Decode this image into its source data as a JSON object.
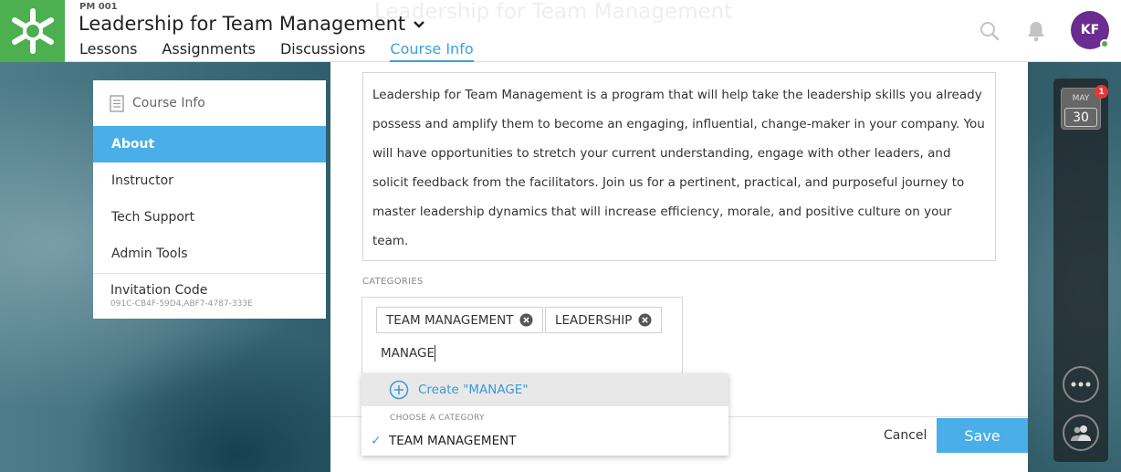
{
  "header": {
    "course_code": "PM 001",
    "course_title": "Leadership for Team Management",
    "ghost_title": "Leadership for Team Management",
    "tabs": [
      {
        "label": "Lessons"
      },
      {
        "label": "Assignments"
      },
      {
        "label": "Discussions"
      },
      {
        "label": "Course Info",
        "active": true
      }
    ],
    "user_initials": "KF"
  },
  "sidebar": {
    "heading": "Course Info",
    "items": [
      {
        "label": "About",
        "active": true
      },
      {
        "label": "Instructor"
      },
      {
        "label": "Tech Support"
      },
      {
        "label": "Admin Tools"
      }
    ],
    "invitation_label": "Invitation Code",
    "invitation_code": "091C-CB4F-59D4,ABF7-4787-333E"
  },
  "main": {
    "description": "Leadership for Team Management is a program that will help take the leadership skills you already possess and amplify them to become an engaging, influential, change-maker in your company. You will have opportunities to stretch your current understanding, engage with other leaders, and solicit feedback from the facilitators. Join us for a pertinent, practical, and purposeful journey to master leadership dynamics that will increase efficiency, morale, and positive culture on your team.",
    "categories_label": "CATEGORIES",
    "tags": [
      "TEAM MANAGEMENT",
      "LEADERSHIP"
    ],
    "typed_value": "MANAGE",
    "cancel_label": "Cancel",
    "save_label": "Save"
  },
  "dropdown": {
    "create_label": "Create \"MANAGE\"",
    "section_label": "CHOOSE A CATEGORY",
    "items": [
      {
        "label": "TEAM MANAGEMENT",
        "checked": true
      }
    ]
  },
  "rail": {
    "calendar_month": "MAY",
    "calendar_day": "30",
    "badge_count": "1"
  },
  "colors": {
    "accent": "#4aaee8",
    "logo_green": "#4caf50",
    "avatar_purple": "#6a2c91"
  }
}
